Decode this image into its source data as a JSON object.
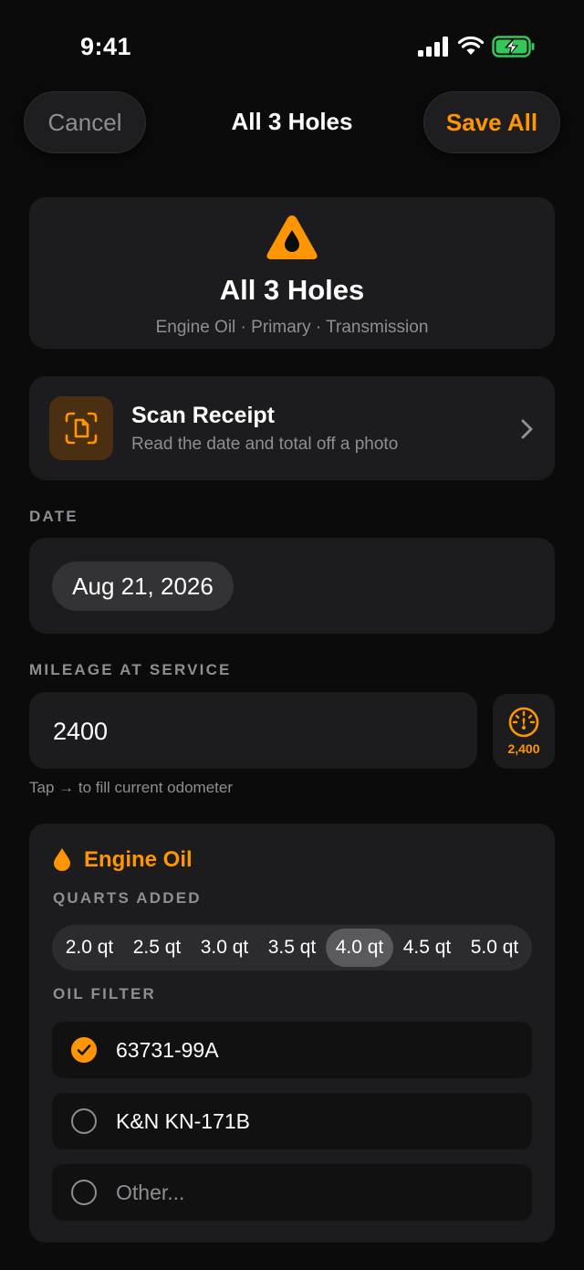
{
  "status": {
    "time": "9:41"
  },
  "nav": {
    "cancel": "Cancel",
    "title": "All 3 Holes",
    "save": "Save All"
  },
  "header": {
    "title": "All 3 Holes",
    "subtitle": "Engine Oil · Primary · Transmission",
    "icon": "oil-drop-icon"
  },
  "scan": {
    "title": "Scan Receipt",
    "subtitle": "Read the date and total off a photo"
  },
  "date": {
    "label": "DATE",
    "value": "Aug 21, 2026"
  },
  "mileage": {
    "label": "MILEAGE AT SERVICE",
    "value": "2400",
    "odometer": "2,400",
    "hint": "Tap → to fill current odometer"
  },
  "engine_oil": {
    "title": "Engine Oil",
    "quarts_label": "QUARTS ADDED",
    "quarts": [
      "2.0 qt",
      "2.5 qt",
      "3.0 qt",
      "3.5 qt",
      "4.0 qt",
      "4.5 qt",
      "5.0 qt"
    ],
    "selected_quart": "4.0 qt",
    "filter_label": "OIL FILTER",
    "filters": [
      {
        "label": "63731-99A",
        "checked": true
      },
      {
        "label": "K&N KN-171B",
        "checked": false
      },
      {
        "label": "Other...",
        "checked": false,
        "placeholder": true
      }
    ]
  },
  "colors": {
    "accent": "#ff9500",
    "background": "#0b0b0c",
    "card": "#1c1c1e"
  }
}
